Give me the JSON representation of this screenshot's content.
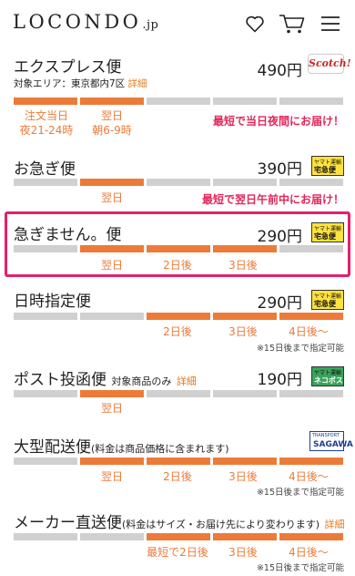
{
  "header": {
    "logo": "LOCONDO",
    "logo_suffix": ".jp",
    "icons": [
      "heart-icon",
      "cart-icon",
      "menu-icon"
    ]
  },
  "rows": [
    {
      "name": "エクスプレス便",
      "sub": "対象エリア：東京都内7区",
      "sub_detail": "詳細",
      "price": "490円",
      "logo": "Scotch!",
      "labels": [
        "注文当日\n夜21-24時",
        "翌日\n朝6-9時"
      ],
      "promo": "最短で当日夜間にお届け！"
    },
    {
      "name": "お急ぎ便",
      "price": "390円",
      "logo_top": "ヤマト運輸",
      "logo_main": "宅急便",
      "labels": [
        "翌日"
      ],
      "promo": "最短で翌日午前中にお届け！"
    },
    {
      "name": "急ぎません。便",
      "price": "290円",
      "logo_top": "ヤマト運輸",
      "logo_main": "宅急便",
      "labels": [
        "翌日",
        "2日後",
        "3日後"
      ]
    },
    {
      "name": "日時指定便",
      "price": "290円",
      "logo_top": "ヤマト運輸",
      "logo_main": "宅急便",
      "labels": [
        "2日後",
        "3日後",
        "4日後〜"
      ],
      "note": "※15日後まで指定可能"
    },
    {
      "name": "ポスト投函便",
      "name_small": "対象商品のみ",
      "name_detail": "詳細",
      "price": "190円",
      "logo_top": "ヤマト運輸",
      "logo_main": "ネコポス",
      "labels": [
        "翌日"
      ]
    },
    {
      "name": "大型配送便",
      "name_small": "(料金は商品価格に含まれます)",
      "logo_top": "TRANSPORT",
      "logo_main": "SAGAWA",
      "labels": [
        "翌日",
        "2日後",
        "3日後",
        "4日後〜"
      ],
      "note": "※15日後まで指定可能"
    },
    {
      "name": "メーカー直送便",
      "name_small": "(料金はサイズ・お届け先により変わります)",
      "name_detail": "詳細",
      "labels": [
        "最短で2日後",
        "3日後",
        "4日後〜"
      ],
      "note": "※15日後まで指定可能"
    }
  ],
  "colors": {
    "accent_orange": "#ec7b3a",
    "inactive_gray": "#d0d0d0",
    "promo_pink": "#e2265a",
    "highlight": "#e61f6a",
    "detail_orange": "#e67a1d"
  }
}
